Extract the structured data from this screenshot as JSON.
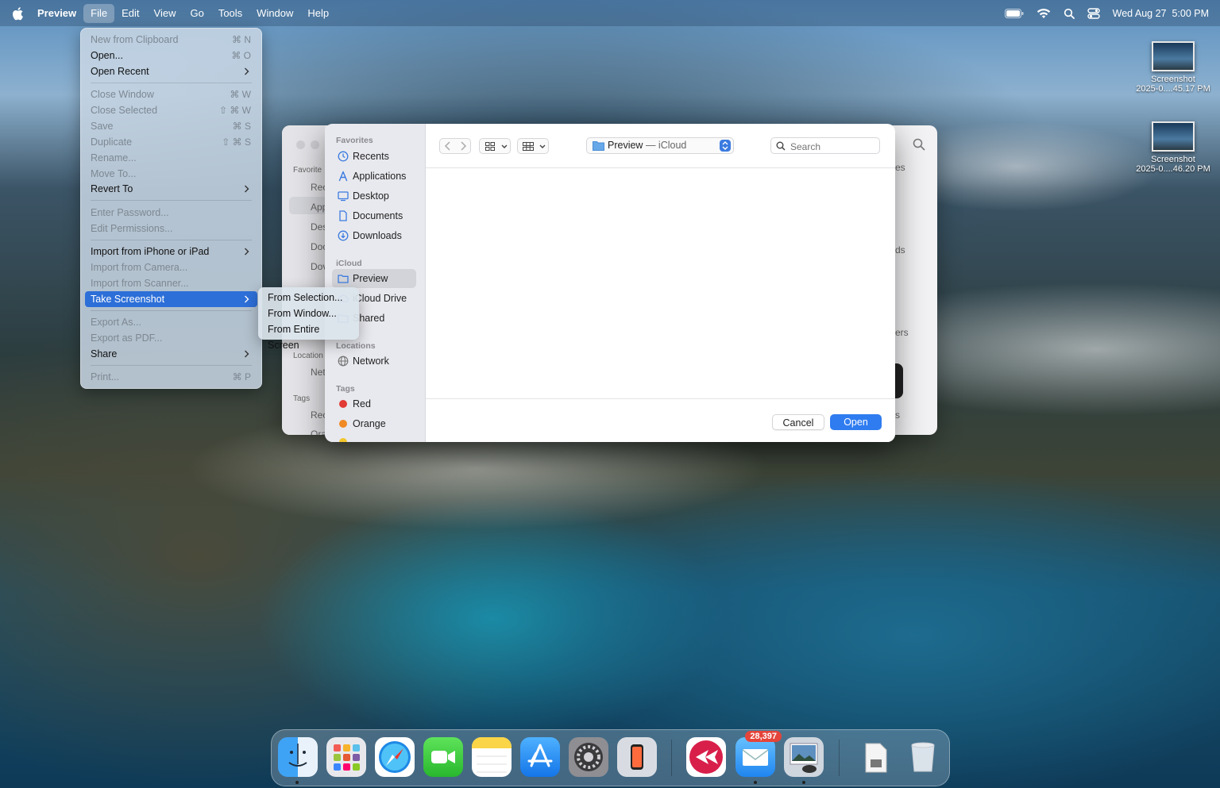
{
  "menubar": {
    "app_name": "Preview",
    "items": [
      "File",
      "Edit",
      "View",
      "Go",
      "Tools",
      "Window",
      "Help"
    ],
    "clock": "Wed Aug 27  5:00 PM"
  },
  "file_menu": {
    "items": [
      {
        "label": "New from Clipboard",
        "shortcut": "⌘ N"
      },
      {
        "label": "Open...",
        "shortcut": "⌘ O"
      },
      {
        "label": "Open Recent"
      },
      {
        "label": "Close Window",
        "shortcut": "⌘ W"
      },
      {
        "label": "Close Selected",
        "shortcut": "⇧ ⌘ W"
      },
      {
        "label": "Save",
        "shortcut": "⌘ S"
      },
      {
        "label": "Duplicate",
        "shortcut": "⇧ ⌘ S"
      },
      {
        "label": "Rename..."
      },
      {
        "label": "Move To..."
      },
      {
        "label": "Revert To"
      },
      {
        "label": "Enter Password..."
      },
      {
        "label": "Edit Permissions..."
      },
      {
        "label": "Import from iPhone or iPad"
      },
      {
        "label": "Import from Camera..."
      },
      {
        "label": "Import from Scanner..."
      },
      {
        "label": "Take Screenshot"
      },
      {
        "label": "Export As..."
      },
      {
        "label": "Export as PDF..."
      },
      {
        "label": "Share"
      },
      {
        "label": "Print...",
        "shortcut": "⌘ P"
      }
    ]
  },
  "submenu": {
    "items": [
      "From Selection...",
      "From Window...",
      "From Entire Screen"
    ]
  },
  "background_window": {
    "labels": [
      "Favorite",
      "Rec",
      "App",
      "Des",
      "Doc",
      "Dov",
      "Location",
      "Net",
      "Tags",
      "Rec",
      "Ora",
      "es",
      "ds",
      "ers",
      "s"
    ]
  },
  "dialog": {
    "sidebar": {
      "favorites_header": "Favorites",
      "favorites": [
        "Recents",
        "Applications",
        "Desktop",
        "Documents",
        "Downloads"
      ],
      "icloud_header": "iCloud",
      "icloud": [
        "Preview",
        "iCloud Drive",
        "Shared"
      ],
      "locations_header": "Locations",
      "locations": [
        "Network"
      ],
      "tags_header": "Tags",
      "tags": [
        {
          "name": "Red",
          "color": "#e23a35"
        },
        {
          "name": "Orange",
          "color": "#f08a24"
        }
      ]
    },
    "path": {
      "folder": "Preview",
      "location": "— iCloud"
    },
    "search_placeholder": "Search",
    "cancel_label": "Cancel",
    "open_label": "Open"
  },
  "desktop_icons": [
    {
      "name": "Screenshot",
      "date": "2025-0....45.17 PM"
    },
    {
      "name": "Screenshot",
      "date": "2025-0....46.20 PM"
    }
  ],
  "dock": {
    "mail_badge": "28,397"
  }
}
